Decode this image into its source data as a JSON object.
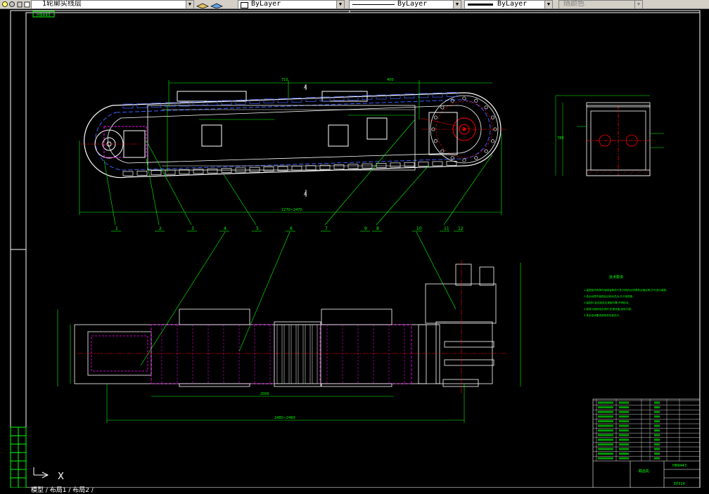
{
  "toolbar": {
    "layer_name": "1轮廓实线层",
    "color_value": "ByLayer",
    "linetype_value": "ByLayer",
    "lineweight_value": "ByLayer",
    "plotstyle_value": "随颜色"
  },
  "drawing": {
    "title_tag": "H9443",
    "balloons": [
      "1",
      "2",
      "3",
      "4",
      "5",
      "6",
      "7",
      "8",
      "9",
      "10",
      "11",
      "12"
    ],
    "notes_title": "技术要求",
    "notes_lines": [
      "1.装配前所有零件用煤油清洗干净,外购件必须具有合格证明,方可进行装配。",
      "2.各运动零件装配后应转动灵活,无卡阻现象。",
      "3.装配时,各连接处应紧固可靠,不得松动。",
      "4.链条与链轮啮合良好,张紧适度,运转平稳。",
      "5.其余技术要求按有关标准执行。"
    ],
    "dims": {
      "top_overall": "2270~2470",
      "bottom_overall": "2480~2460",
      "bottom_inner": "2000",
      "top_span": "710",
      "top_span2": "400",
      "side_height": "780"
    },
    "title_block": {
      "name": "截齿机",
      "drawing_no": "EP324",
      "company": "HB9443"
    }
  },
  "statusbar": {
    "tabs_text": "模型 / 布局1 / 布局2 /",
    "axis_x": "X"
  },
  "colors": {
    "background": "#000000",
    "outline": "#ffffff",
    "dimension": "#00ff00",
    "hidden": "#ff00ff",
    "center": "#ff0000",
    "chain": "#4060ff",
    "note_text": "#00ff00"
  }
}
